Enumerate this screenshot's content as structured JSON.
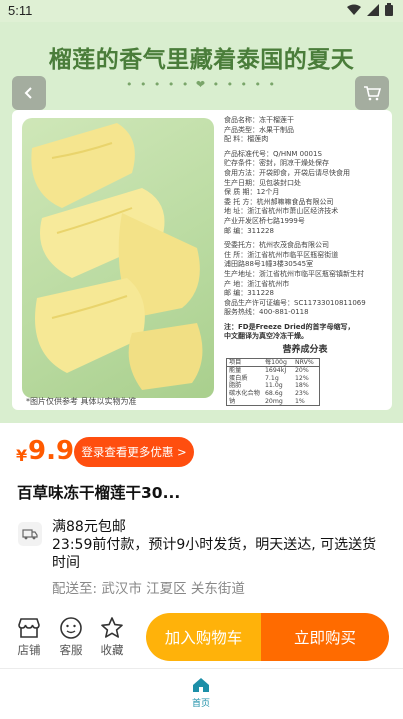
{
  "status_bar": {
    "time": "5:11"
  },
  "hero": {
    "title": "榴莲的香气里藏着泰国的夏天",
    "dots": "• • • • •  ❤  • • • • •",
    "info_rows": [
      "食品名称：冻干榴莲干",
      "产品类型：水果干制品",
      "配    料：榴莲肉",
      "",
      "产品标准代号：Q/HNM 0001S",
      "贮存条件：密封，阴凉干燥处保存",
      "食用方法：开袋即食，开袋后请尽快食用",
      "生产日期：见包装封口处",
      "保 质 期：12个月",
      "委 托 方：杭州郝嘛嘛食品有限公司",
      "地    址：浙江省杭州市萧山区经济技术",
      "          产业开发区桥七路1999号",
      "邮    编：311228",
      "",
      "受委托方：杭州农茂食品有限公司",
      "住    所：浙江省杭州市临平区瓶窑街道",
      "          浦田路88号1幢3楼30545室",
      "生产地址：浙江省杭州市临平区瓶窑镇新生村",
      "产    地：浙江省杭州市",
      "邮    编：311228",
      "食品生产许可证编号：SC11733010811069",
      "服务热线：400-881-0118"
    ],
    "note_lines": [
      "注：FD是Freeze Dried的首字母缩写，",
      "中文翻译为真空冷冻干燥。"
    ],
    "nutrition": {
      "title": "营养成分表",
      "header": [
        "项目",
        "每100g",
        "NRV%"
      ],
      "rows": [
        [
          "能量",
          "1694kJ",
          "20%"
        ],
        [
          "蛋白质",
          "7.1g",
          "12%"
        ],
        [
          "脂肪",
          "11.0g",
          "18%"
        ],
        [
          "碳水化合物",
          "68.6g",
          "23%"
        ],
        [
          "钠",
          "20mg",
          "1%"
        ]
      ]
    },
    "disclaimer": "*图片仅供参考 具体以实物为准"
  },
  "price": {
    "currency": "¥",
    "value": "9.9",
    "promo_label": "登录查看更多优惠 >"
  },
  "product_title": "百草味冻干榴莲干30...",
  "shipping": {
    "line1": "满88元包邮",
    "line2": "23:59前付款，预计9小时发货，明天送达, 可选送货时间",
    "address": "配送至: 武汉市 江夏区 关东街道"
  },
  "bottom_bar": {
    "store": "店铺",
    "service": "客服",
    "favorite": "收藏",
    "add_cart": "加入购物车",
    "buy_now": "立即购买"
  },
  "tabbar": {
    "home": "首页"
  },
  "colors": {
    "accent": "#ff5a00",
    "cart": "#ffb20a",
    "buy": "#ff6b00",
    "hero_bg": "#d9eecf",
    "tab_active": "#1c8fa8"
  }
}
